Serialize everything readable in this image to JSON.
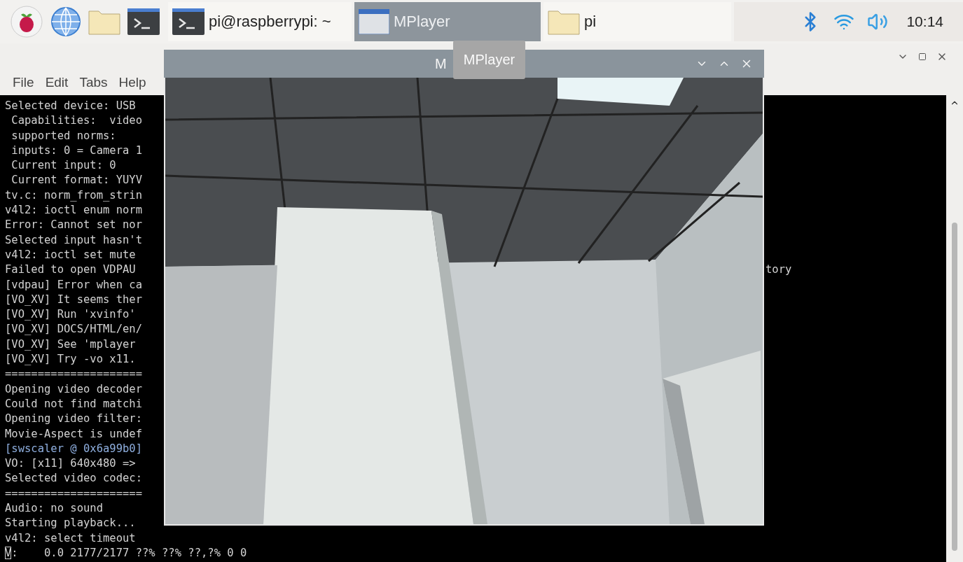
{
  "taskbar": {
    "tasks": [
      {
        "label": "pi@raspberrypi: ~",
        "kind": "terminal",
        "selected": false
      },
      {
        "label": "MPlayer",
        "kind": "window",
        "selected": true
      },
      {
        "label": "pi",
        "kind": "folder",
        "selected": false
      }
    ],
    "clock": "10:14"
  },
  "terminal_window": {
    "menu": [
      "File",
      "Edit",
      "Tabs",
      "Help"
    ],
    "lines": [
      {
        "kind": "plain",
        "text": "Selected device: USB"
      },
      {
        "kind": "plain",
        "text": " Capabilities:  video"
      },
      {
        "kind": "plain",
        "text": " supported norms:"
      },
      {
        "kind": "plain",
        "text": " inputs: 0 = Camera 1"
      },
      {
        "kind": "plain",
        "text": " Current input: 0"
      },
      {
        "kind": "plain",
        "text": " Current format: YUYV"
      },
      {
        "kind": "plain",
        "text": "tv.c: norm_from_strin"
      },
      {
        "kind": "plain",
        "text": "v4l2: ioctl enum norm"
      },
      {
        "kind": "plain",
        "text": "Error: Cannot set nor"
      },
      {
        "kind": "plain",
        "text": "Selected input hasn't"
      },
      {
        "kind": "plain",
        "text": "v4l2: ioctl set mute"
      },
      {
        "kind": "plain",
        "text": "Failed to open VDPAU",
        "right": "tory"
      },
      {
        "kind": "plain",
        "text": "[vdpau] Error when ca"
      },
      {
        "kind": "plain",
        "text": "[VO_XV] It seems ther"
      },
      {
        "kind": "plain",
        "text": "[VO_XV] Run 'xvinfo'"
      },
      {
        "kind": "plain",
        "text": "[VO_XV] DOCS/HTML/en/"
      },
      {
        "kind": "plain",
        "text": "[VO_XV] See 'mplayer"
      },
      {
        "kind": "plain",
        "text": "[VO_XV] Try -vo x11."
      },
      {
        "kind": "plain",
        "text": "====================="
      },
      {
        "kind": "plain",
        "text": "Opening video decoder"
      },
      {
        "kind": "plain",
        "text": "Could not find matchi"
      },
      {
        "kind": "plain",
        "text": "Opening video filter:"
      },
      {
        "kind": "plain",
        "text": "Movie-Aspect is undef"
      },
      {
        "kind": "highlight",
        "text": "[swscaler @ 0x6a99b0]"
      },
      {
        "kind": "plain",
        "text": "VO: [x11] 640x480 =>"
      },
      {
        "kind": "plain",
        "text": "Selected video codec:"
      },
      {
        "kind": "plain",
        "text": "====================="
      },
      {
        "kind": "plain",
        "text": "Audio: no sound"
      },
      {
        "kind": "plain",
        "text": "Starting playback..."
      },
      {
        "kind": "plain",
        "text": "v4l2: select timeout"
      },
      {
        "kind": "status",
        "cursor": "V",
        "text": ":    0.0 2177/2177 ??% ??% ??,?% 0 0"
      }
    ]
  },
  "mplayer_window": {
    "title": "M",
    "tooltip": "MPlayer"
  }
}
